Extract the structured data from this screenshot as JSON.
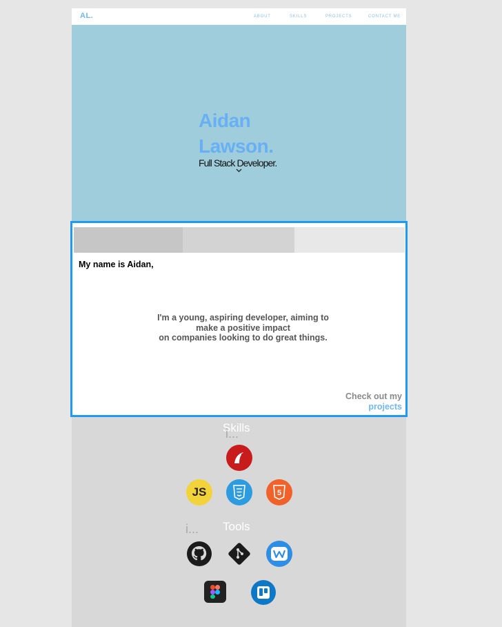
{
  "nav": {
    "logo": "AL.",
    "links": [
      "ABOUT",
      "SKILLS",
      "PROJECTS",
      "CONTACT ME"
    ]
  },
  "hero": {
    "first_name": "Aidan",
    "last_name": "Lawson.",
    "role": "Full Stack Developer.",
    "scroll_icon": "chevron-down-icon"
  },
  "about": {
    "greeting": "My name is Aidan,",
    "body_line1": "I'm a young, aspiring developer, aiming to",
    "body_line2": "make a positive impact",
    "body_line3": "on companies looking to do great things.",
    "cta_text": "Check out my",
    "cta_link": "projects"
  },
  "skills": {
    "title": "Skills",
    "ellipsis": "i...",
    "icons": [
      "rails-icon",
      "javascript-icon",
      "css3-icon",
      "html5-icon"
    ]
  },
  "tools": {
    "title": "Tools",
    "ellipsis": "i...",
    "icons": [
      "github-icon",
      "git-icon",
      "weebly-icon",
      "figma-icon",
      "trello-icon"
    ]
  },
  "colors": {
    "accent": "#68b0f3",
    "hero_bg": "#9fcddc",
    "focus_border": "#1e9af2"
  }
}
